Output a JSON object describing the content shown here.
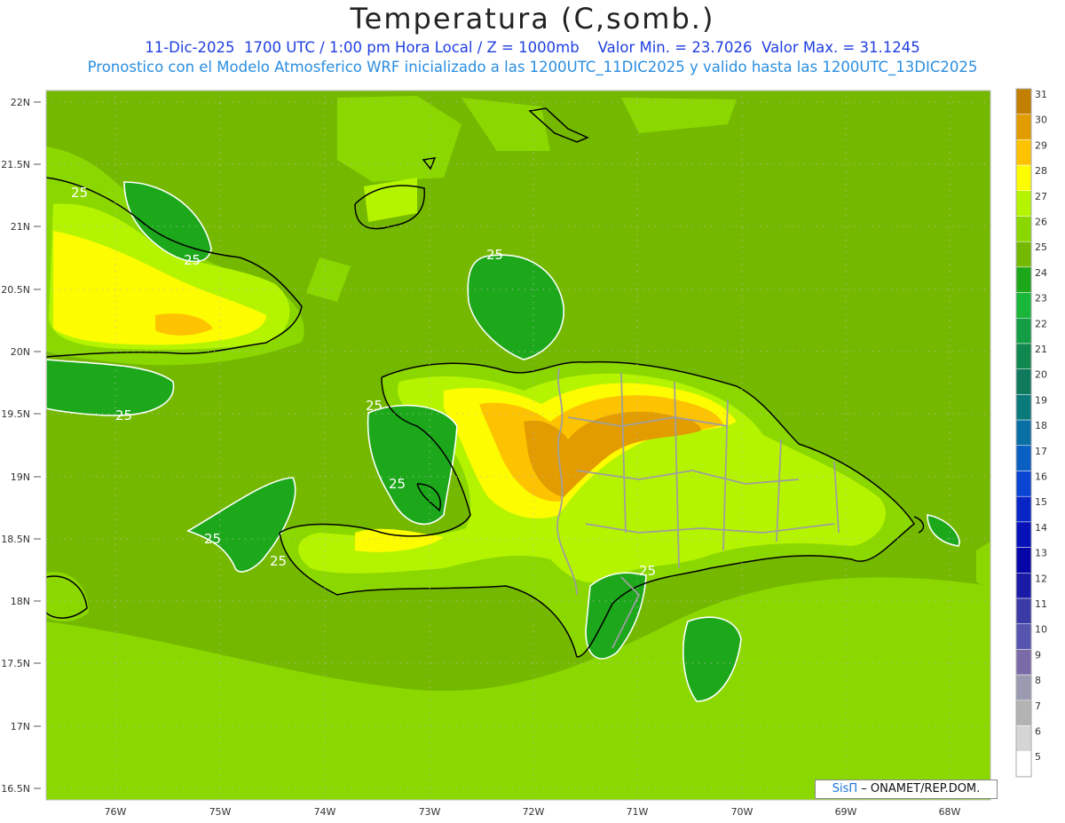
{
  "header": {
    "title": "Temperatura (C,somb.)",
    "date": "11-Dic-2025",
    "time": "1700 UTC / 1:00 pm Hora Local / Z = 1000mb",
    "min": "Valor Min. = 23.7026",
    "max": "Valor Max. = 31.1245",
    "subtitle": "Pronostico con el Modelo Atmosferico WRF inicializado a las 1200UTC_11DIC2025 y valido hasta las  1200UTC_13DIC2025"
  },
  "axes": {
    "lat_labels": [
      "22N",
      "21.5N",
      "21N",
      "20.5N",
      "20N",
      "19.5N",
      "19N",
      "18.5N",
      "18N",
      "17.5N",
      "17N",
      "16.5N"
    ],
    "lon_labels": [
      "76W",
      "75W",
      "74W",
      "73W",
      "72W",
      "71W",
      "70W",
      "69W",
      "68W"
    ]
  },
  "contour_labels": [
    "25",
    "25",
    "25",
    "25",
    "25",
    "25",
    "25",
    "25",
    "25",
    "25"
  ],
  "colorbar": {
    "labels": [
      "31",
      "30",
      "29",
      "28",
      "27",
      "26",
      "25",
      "24",
      "23",
      "22",
      "21",
      "20",
      "19",
      "18",
      "17",
      "16",
      "15",
      "14",
      "13",
      "12",
      "11",
      "10",
      "9",
      "8",
      "7",
      "6",
      "5"
    ],
    "colors": [
      "#c37f00",
      "#e29c00",
      "#fdc200",
      "#fdfc00",
      "#b5f400",
      "#8bd800",
      "#74b900",
      "#1da81b",
      "#19b63a",
      "#139e46",
      "#11884f",
      "#0f7a5d",
      "#0b7a7a",
      "#0a6fa4",
      "#0a5fc2",
      "#0a44d2",
      "#0826c6",
      "#0612b8",
      "#0606a8",
      "#1a1aa8",
      "#3b3ba8",
      "#5555b0",
      "#7a6aa8",
      "#9a9ab0",
      "#b3b3b3",
      "#d5d5d5",
      "#ffffff"
    ]
  },
  "credit": {
    "sis": "SisΠ",
    "org": "– ONAMET/REP.DOM."
  }
}
